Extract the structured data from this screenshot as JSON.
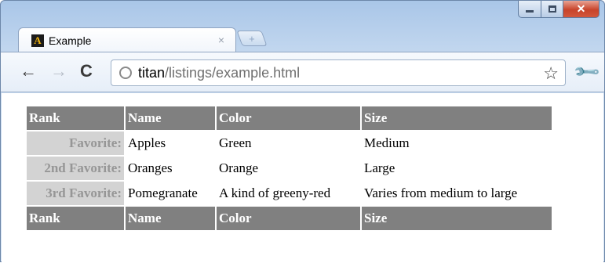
{
  "window": {
    "controls": {
      "minimize": "minimize",
      "maximize": "maximize",
      "close": "✕"
    }
  },
  "tab": {
    "favicon_letter": "A",
    "title": "Example",
    "close_glyph": "×",
    "new_tab_glyph": "+"
  },
  "toolbar": {
    "back_glyph": "←",
    "forward_glyph": "→",
    "reload_glyph": "C",
    "url_host": "titan",
    "url_path": "/listings/example.html",
    "star_glyph": "☆",
    "wrench_glyph": "🔧"
  },
  "table": {
    "headers": [
      "Rank",
      "Name",
      "Color",
      "Size"
    ],
    "rows": [
      {
        "rank": "Favorite:",
        "name": "Apples",
        "color": "Green",
        "size": "Medium"
      },
      {
        "rank": "2nd Favorite:",
        "name": "Oranges",
        "color": "Orange",
        "size": "Large"
      },
      {
        "rank": "3rd Favorite:",
        "name": "Pomegranate",
        "color": "A kind of greeny-red",
        "size": "Varies from medium to large"
      }
    ],
    "footers": [
      "Rank",
      "Name",
      "Color",
      "Size"
    ]
  },
  "colors": {
    "header_bg": "#808080",
    "rowhead_bg": "#d3d3d3",
    "rowhead_text": "#969696"
  }
}
